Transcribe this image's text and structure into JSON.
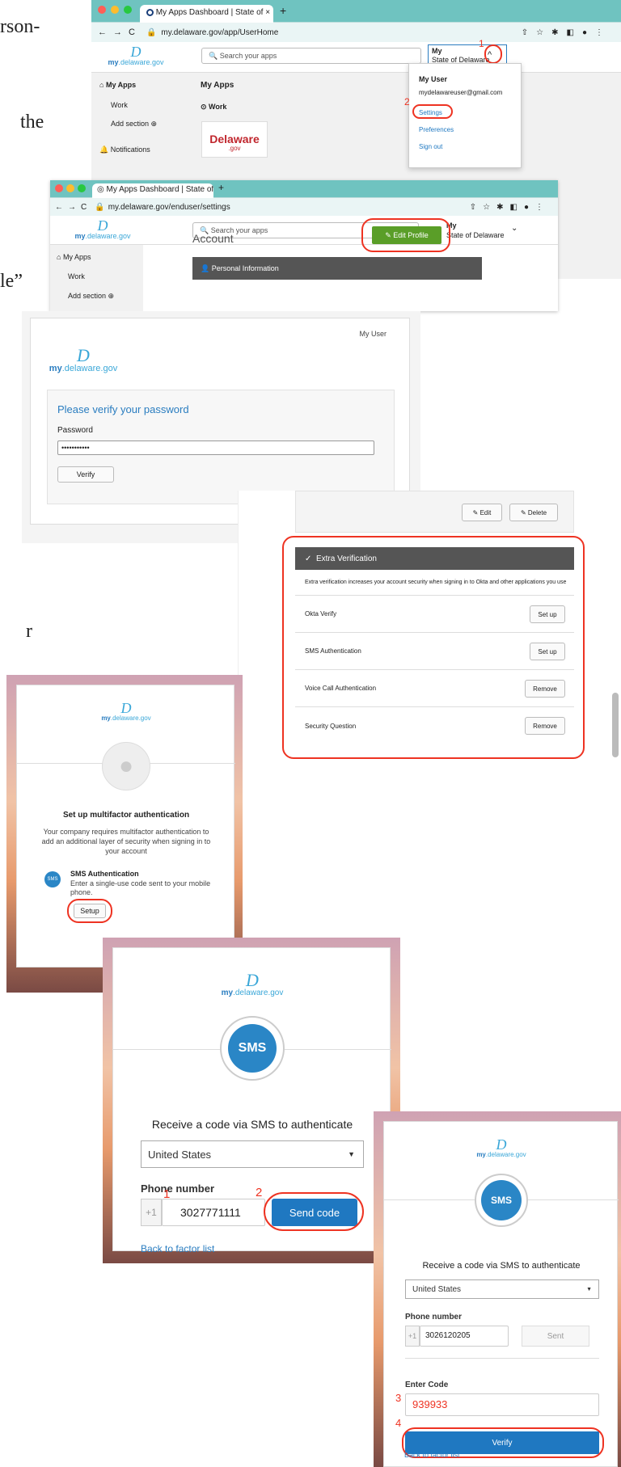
{
  "background_text": {
    "line1": "rson-",
    "line2": "the",
    "line3": "le”",
    "line4": "r"
  },
  "screen1": {
    "tab_title": "My Apps Dashboard | State of",
    "url": "my.delaware.gov/app/UserHome",
    "logo": {
      "symbol": "D",
      "my": "my",
      "rest": ".delaware.gov"
    },
    "search_placeholder": "Search your apps",
    "account_line1": "My",
    "account_line2": "State of Delaware",
    "sidebar": {
      "my_apps": "My Apps",
      "work": "Work",
      "add_section": "Add section",
      "notifications": "Notifications"
    },
    "main": {
      "heading": "My Apps",
      "work": "Work",
      "tile_line1": "Delaware",
      "tile_line2": ".gov"
    },
    "menu": {
      "user": "My User",
      "email": "mydelawareuser@gmail.com",
      "settings": "Settings",
      "preferences": "Preferences",
      "signout": "Sign out"
    },
    "step1": "1",
    "step2": "2"
  },
  "screen2": {
    "tab_title": "My Apps Dashboard | State of",
    "url": "my.delaware.gov/enduser/settings",
    "logo": {
      "symbol": "D",
      "my": "my",
      "rest": ".delaware.gov"
    },
    "search_placeholder": "Search your apps",
    "account_line1": "My",
    "account_line2": "State of Delaware",
    "sidebar": {
      "my_apps": "My Apps",
      "work": "Work",
      "add_section": "Add section"
    },
    "account_heading": "Account",
    "edit_profile": "Edit Profile",
    "personal_info": "Personal Information"
  },
  "screen3": {
    "user": "My User",
    "logo": {
      "symbol": "D",
      "my": "my",
      "rest": ".delaware.gov"
    },
    "title": "Please verify your password",
    "password_label": "Password",
    "password_value": "•••••••••••",
    "verify": "Verify"
  },
  "screen4": {
    "edit": "Edit",
    "delete": "Delete",
    "extra_verification": "Extra Verification",
    "description": "Extra verification increases your account security when signing in to Okta and other applications you use",
    "rows": [
      {
        "name": "Okta Verify",
        "action": "Set up"
      },
      {
        "name": "SMS Authentication",
        "action": "Set up"
      },
      {
        "name": "Voice Call Authentication",
        "action": "Remove"
      },
      {
        "name": "Security Question",
        "action": "Remove"
      }
    ]
  },
  "screen5": {
    "logo": {
      "symbol": "D",
      "my": "my",
      "rest": ".delaware.gov"
    },
    "title": "Set up multifactor authentication",
    "description": "Your company requires multifactor authentication to add an additional layer of security when signing in to your account",
    "factor_name": "SMS Authentication",
    "factor_desc": "Enter a single-use code sent to your mobile phone.",
    "sms_badge": "SMS",
    "setup": "Setup"
  },
  "screen6": {
    "logo": {
      "symbol": "D",
      "my": "my",
      "rest": ".delaware.gov"
    },
    "sms": "SMS",
    "title": "Receive a code via SMS to authenticate",
    "country": "United States",
    "phone_label": "Phone number",
    "country_code": "+1",
    "phone": "3027771111",
    "send_code": "Send code",
    "back": "Back to factor list",
    "step1": "1",
    "step2": "2"
  },
  "screen7": {
    "logo": {
      "symbol": "D",
      "my": "my",
      "rest": ".delaware.gov"
    },
    "sms": "SMS",
    "title": "Receive a code via SMS to authenticate",
    "country": "United States",
    "phone_label": "Phone number",
    "country_code": "+1",
    "phone": "3026120205",
    "sent": "Sent",
    "enter_code_label": "Enter Code",
    "code": "939933",
    "verify": "Verify",
    "back": "Back to factor list",
    "step3": "3",
    "step4": "4"
  },
  "colors": {
    "accent_red": "#e32222",
    "green": "#5a9e28",
    "blue": "#1f78c1",
    "chrome_teal": "#6fc3c0"
  }
}
